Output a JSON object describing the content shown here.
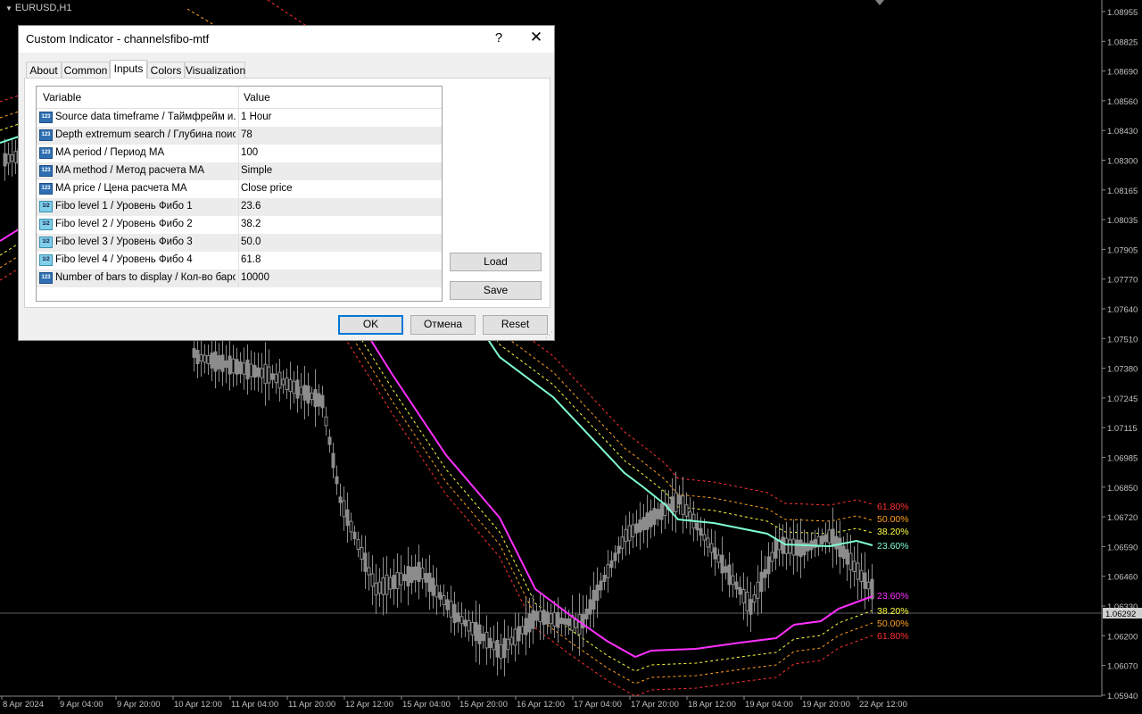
{
  "chart": {
    "symbol": "EURUSD,H1",
    "price_labels": [
      "1.08955",
      "1.08825",
      "1.08690",
      "1.08560",
      "1.08430",
      "1.08300",
      "1.08165",
      "1.08035",
      "1.07905",
      "1.07770",
      "1.07640",
      "1.07510",
      "1.07380",
      "1.07245",
      "1.07115",
      "1.06985",
      "1.06850",
      "1.06720",
      "1.06590",
      "1.06460",
      "1.06330",
      "1.06200",
      "1.06070",
      "1.05940"
    ],
    "current_price": "1.06292",
    "time_labels": [
      "8 Apr 2024",
      "9 Apr 04:00",
      "9 Apr 20:00",
      "10 Apr 12:00",
      "11 Apr 04:00",
      "11 Apr 20:00",
      "12 Apr 12:00",
      "15 Apr 04:00",
      "15 Apr 20:00",
      "16 Apr 12:00",
      "17 Apr 04:00",
      "17 Apr 20:00",
      "18 Apr 12:00",
      "19 Apr 04:00",
      "19 Apr 20:00",
      "22 Apr 12:00"
    ],
    "fib_labels_upper": [
      {
        "text": "61.80%",
        "color": "#ff3030"
      },
      {
        "text": "50.00%",
        "color": "#ffa020"
      },
      {
        "text": "38.20%",
        "color": "#ffff40"
      },
      {
        "text": "23.60%",
        "color": "#7fffd4"
      }
    ],
    "fib_labels_lower": [
      {
        "text": "23.60%",
        "color": "#ff30ff"
      },
      {
        "text": "38.20%",
        "color": "#ffff40"
      },
      {
        "text": "50.00%",
        "color": "#ffa020"
      },
      {
        "text": "61.80%",
        "color": "#ff3030"
      }
    ],
    "colors": {
      "upper_ma": "#7fffd4",
      "lower_ma": "#ff30ff",
      "fib_618": "#ff3030",
      "fib_500": "#ffa020",
      "fib_382": "#ffff40",
      "candle": "#8c8c8c",
      "grid": "#404040"
    }
  },
  "dialog": {
    "title": "Custom Indicator - channelsfibo-mtf",
    "help_label": "?",
    "close_label": "✕",
    "tabs": [
      "About",
      "Common",
      "Inputs",
      "Colors",
      "Visualization"
    ],
    "active_tab": "Inputs",
    "table": {
      "col_variable": "Variable",
      "col_value": "Value",
      "rows": [
        {
          "icon": "int",
          "name": "Source data timeframe / Таймфрейм и...",
          "value": "1 Hour"
        },
        {
          "icon": "int",
          "name": "Depth extremum search / Глубина поис...",
          "value": "78"
        },
        {
          "icon": "int",
          "name": "MA period / Период MA",
          "value": "100"
        },
        {
          "icon": "int",
          "name": "MA method / Метод расчета MA",
          "value": "Simple"
        },
        {
          "icon": "int",
          "name": "MA price / Цена расчета MA",
          "value": "Close price"
        },
        {
          "icon": "dbl",
          "name": "Fibo level 1 / Уровень Фибо 1",
          "value": "23.6"
        },
        {
          "icon": "dbl",
          "name": "Fibo level 2 / Уровень Фибо 2",
          "value": "38.2"
        },
        {
          "icon": "dbl",
          "name": "Fibo level 3 / Уровень Фибо 3",
          "value": "50.0"
        },
        {
          "icon": "dbl",
          "name": "Fibo level 4 / Уровень Фибо 4",
          "value": "61.8"
        },
        {
          "icon": "int",
          "name": "Number of bars to display / Кол-во баро...",
          "value": "10000"
        }
      ]
    },
    "icon_text": {
      "int": "123",
      "dbl": "1/2"
    },
    "buttons": {
      "load": "Load",
      "save": "Save",
      "ok": "OK",
      "cancel": "Отмена",
      "reset": "Reset"
    }
  }
}
